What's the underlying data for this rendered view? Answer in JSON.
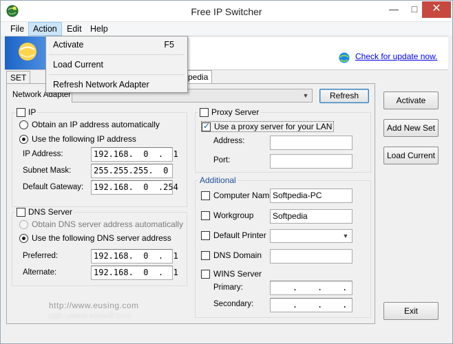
{
  "window": {
    "title": "Free IP Switcher",
    "minimize": "—",
    "maximize": "□",
    "close": "✕"
  },
  "menubar": {
    "file": "File",
    "action": "Action",
    "edit": "Edit",
    "help": "Help"
  },
  "action_menu": {
    "activate": "Activate",
    "activate_shortcut": "F5",
    "load_current": "Load Current",
    "refresh_adapter": "Refresh Network Adapter"
  },
  "banner": {
    "update_link": "Check for update now."
  },
  "tabs": {
    "first": "SET",
    "last": "pedia"
  },
  "network_adapter": {
    "label": "Network Adapter:",
    "value": "",
    "refresh_button": "Refresh"
  },
  "ip_group": {
    "title": "IP",
    "auto": "Obtain an IP address automatically",
    "manual": "Use the following IP address",
    "ip_label": "IP Address:",
    "ip_value": "192.168.  0  .  1",
    "mask_label": "Subnet Mask:",
    "mask_value": "255.255.255.  0",
    "gateway_label": "Default Gateway:",
    "gateway_value": "192.168.  0  .254"
  },
  "dns_group": {
    "title": "DNS Server",
    "auto": "Obtain DNS server address automatically",
    "manual": "Use the following DNS server address",
    "preferred_label": "Preferred:",
    "preferred_value": "192.168.  0  .  1",
    "alternate_label": "Alternate:",
    "alternate_value": "192.168.  0  .  1"
  },
  "proxy_group": {
    "title": "Proxy Server",
    "use_proxy": "Use a proxy server for your LAN",
    "address_label": "Address:",
    "address_value": "",
    "port_label": "Port:",
    "port_value": ""
  },
  "additional_group": {
    "title": "Additional",
    "computer_name_label": "Computer Name",
    "computer_name_value": "Softpedia-PC",
    "workgroup_label": "Workgroup",
    "workgroup_value": "Softpedia",
    "default_printer_label": "Default Printer",
    "default_printer_value": "",
    "dns_domain_label": "DNS Domain",
    "dns_domain_value": "",
    "wins_label": "WINS Server",
    "primary_label": "Primary:",
    "primary_value": "    .    .    .",
    "secondary_label": "Secondary:",
    "secondary_value": "    .    .    ."
  },
  "side_buttons": {
    "activate": "Activate",
    "add_new_set": "Add New Set",
    "load_current": "Load Current",
    "exit": "Exit"
  },
  "watermark": "http://www.eusing.com",
  "colors": {
    "accent": "#1b63c6",
    "link": "#0000ee",
    "close": "#c7483f"
  }
}
